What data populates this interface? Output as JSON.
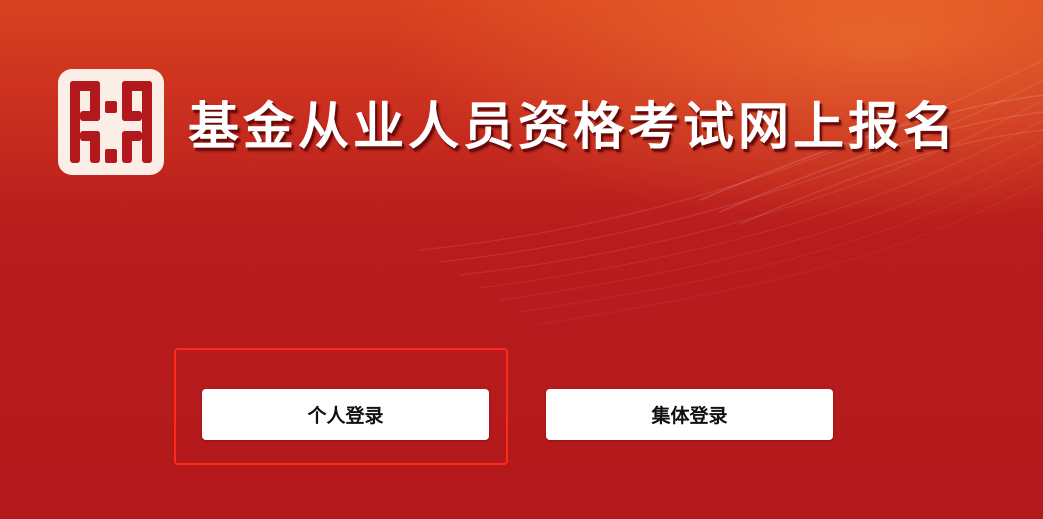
{
  "header": {
    "site_title": "基金从业人员资格考试网上报名",
    "logo_icon": "association-seal-logo"
  },
  "login": {
    "personal_label": "个人登录",
    "group_label": "集体登录"
  },
  "colors": {
    "background_top": "#d9421f",
    "background_bottom": "#b3181c",
    "highlight_border": "#ff2a1a",
    "button_bg": "#ffffff",
    "button_text": "#111111"
  }
}
